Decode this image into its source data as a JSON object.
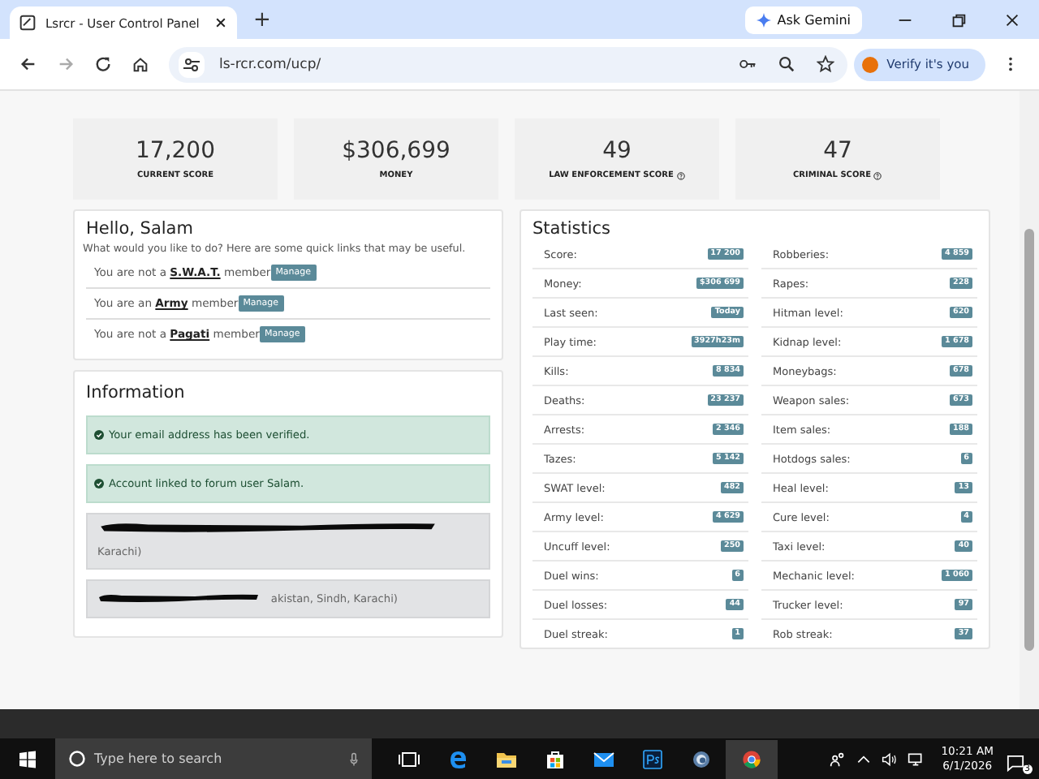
{
  "browser": {
    "tab_title": "Lsrcr - User Control Panel",
    "new_tab": "+",
    "ask_gemini": "Ask Gemini",
    "url": "ls-rcr.com/ucp/",
    "verify": "Verify it's you"
  },
  "score_cards": [
    {
      "value": "17,200",
      "label": "CURRENT SCORE",
      "help": false
    },
    {
      "value": "$306,699",
      "label": "MONEY",
      "help": false
    },
    {
      "value": "49",
      "label": "LAW ENFORCEMENT SCORE",
      "help": true
    },
    {
      "value": "47",
      "label": "CRIMINAL SCORE",
      "help": true
    }
  ],
  "hello": {
    "title": "Hello, Salam",
    "intro": "What would you like to do? Here are some quick links that may be useful.",
    "memberships": [
      {
        "prefix": "You are not a ",
        "link": "S.W.A.T.",
        "suffix": " member",
        "button": "Manage"
      },
      {
        "prefix": "You are an ",
        "link": "Army",
        "suffix": " member",
        "button": "Manage"
      },
      {
        "prefix": "You are not a ",
        "link": "Pagati",
        "suffix": " member",
        "button": "Manage"
      }
    ]
  },
  "information": {
    "title": "Information",
    "items": [
      {
        "kind": "success",
        "text": "Your email address has been verified."
      },
      {
        "kind": "success",
        "text": "Account linked to forum user Salam."
      },
      {
        "kind": "redacted",
        "text": "Karachi)",
        "wrapped": true
      },
      {
        "kind": "redacted",
        "text": "akistan, Sindh, Karachi)",
        "wrapped": false
      }
    ]
  },
  "statistics": {
    "title": "Statistics",
    "left": [
      {
        "label": "Score:",
        "value": "17 200"
      },
      {
        "label": "Money:",
        "value": "$306 699"
      },
      {
        "label": "Last seen:",
        "value": "Today"
      },
      {
        "label": "Play time:",
        "value": "3927h23m"
      },
      {
        "label": "Kills:",
        "value": "8 834"
      },
      {
        "label": "Deaths:",
        "value": "23 237"
      },
      {
        "label": "Arrests:",
        "value": "2 346"
      },
      {
        "label": "Tazes:",
        "value": "5 142"
      },
      {
        "label": "SWAT level:",
        "value": "482"
      },
      {
        "label": "Army level:",
        "value": "4 629"
      },
      {
        "label": "Uncuff level:",
        "value": "250"
      },
      {
        "label": "Duel wins:",
        "value": "6"
      },
      {
        "label": "Duel losses:",
        "value": "44"
      },
      {
        "label": "Duel streak:",
        "value": "1"
      }
    ],
    "right": [
      {
        "label": "Robberies:",
        "value": "4 859"
      },
      {
        "label": "Rapes:",
        "value": "228"
      },
      {
        "label": "Hitman level:",
        "value": "620"
      },
      {
        "label": "Kidnap level:",
        "value": "1 678"
      },
      {
        "label": "Moneybags:",
        "value": "678"
      },
      {
        "label": "Weapon sales:",
        "value": "673"
      },
      {
        "label": "Item sales:",
        "value": "188"
      },
      {
        "label": "Hotdogs sales:",
        "value": "6"
      },
      {
        "label": "Heal level:",
        "value": "13"
      },
      {
        "label": "Cure level:",
        "value": "4"
      },
      {
        "label": "Taxi level:",
        "value": "40"
      },
      {
        "label": "Mechanic level:",
        "value": "1 060"
      },
      {
        "label": "Trucker level:",
        "value": "97"
      },
      {
        "label": "Rob streak:",
        "value": "37"
      }
    ]
  },
  "taskbar": {
    "search_placeholder": "Type here to search",
    "time": "10:21 AM",
    "date": "6/1/2026",
    "notifications": "3"
  }
}
